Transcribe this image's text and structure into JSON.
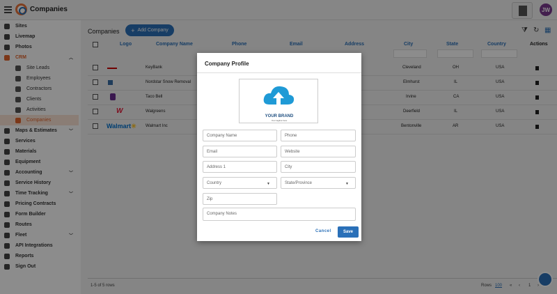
{
  "app": {
    "title": "Companies",
    "avatar_initials": "JW"
  },
  "sidebar": {
    "items": [
      {
        "label": "Sites",
        "icon": "folder-icon"
      },
      {
        "label": "Livemap",
        "icon": "globe-icon"
      },
      {
        "label": "Photos",
        "icon": "image-icon"
      },
      {
        "label": "CRM",
        "icon": "crm-icon"
      },
      {
        "label": "Site Leads",
        "icon": "folder-icon"
      },
      {
        "label": "Employees",
        "icon": "id-card-icon"
      },
      {
        "label": "Contractors",
        "icon": "contractor-icon"
      },
      {
        "label": "Clients",
        "icon": "user-icon"
      },
      {
        "label": "Activities",
        "icon": "list-icon"
      },
      {
        "label": "Companies",
        "icon": "building-icon"
      },
      {
        "label": "Maps & Estimates",
        "icon": "map-icon"
      },
      {
        "label": "Services",
        "icon": "wrench-icon"
      },
      {
        "label": "Materials",
        "icon": "materials-icon"
      },
      {
        "label": "Equipment",
        "icon": "equipment-icon"
      },
      {
        "label": "Accounting",
        "icon": "accounting-icon"
      },
      {
        "label": "Service History",
        "icon": "history-icon"
      },
      {
        "label": "Time Tracking",
        "icon": "clock-icon"
      },
      {
        "label": "Pricing Contracts",
        "icon": "dollar-icon"
      },
      {
        "label": "Form Builder",
        "icon": "form-icon"
      },
      {
        "label": "Routes",
        "icon": "route-icon"
      },
      {
        "label": "Fleet",
        "icon": "truck-icon"
      },
      {
        "label": "API Integrations",
        "icon": "link-icon"
      },
      {
        "label": "Reports",
        "icon": "report-icon"
      },
      {
        "label": "Sign Out",
        "icon": "power-icon"
      }
    ]
  },
  "main": {
    "title": "Companies",
    "add_button": "Add Company",
    "columns": [
      "Logo",
      "Company Name",
      "Phone",
      "Email",
      "Address",
      "City",
      "State",
      "Country",
      "Actions"
    ],
    "rows": [
      {
        "name": "KeyBank",
        "city": "Cleveland",
        "state": "OH",
        "country": "USA"
      },
      {
        "name": "Nordstar Snow Removal",
        "city": "Elmhurst",
        "state": "IL",
        "country": "USA"
      },
      {
        "name": "Taco Bell",
        "city": "Irvine",
        "state": "CA",
        "country": "USA"
      },
      {
        "name": "Walgreens",
        "city": "Deerfield",
        "state": "IL",
        "country": "USA"
      },
      {
        "name": "Walmart Inc",
        "city": "Bentonville",
        "state": "AR",
        "country": "USA"
      }
    ],
    "footer": {
      "range": "1-5 of 5 rows",
      "rows_label": "Rows",
      "rows_value": "100",
      "page": "1"
    }
  },
  "modal": {
    "title": "Company Profile",
    "brand_text": "YOUR BRAND",
    "brand_tagline": "Your tagline here",
    "fields": {
      "company_name": "Company Name",
      "phone": "Phone",
      "email": "Email",
      "website": "Website",
      "address1": "Address 1",
      "city": "City",
      "country": "Country",
      "state": "State/Province",
      "zip": "Zip",
      "notes": "Company Notes"
    },
    "cancel": "Cancel",
    "save": "Save"
  },
  "colors": {
    "accent": "#2a70b8",
    "active": "#e2652c"
  }
}
